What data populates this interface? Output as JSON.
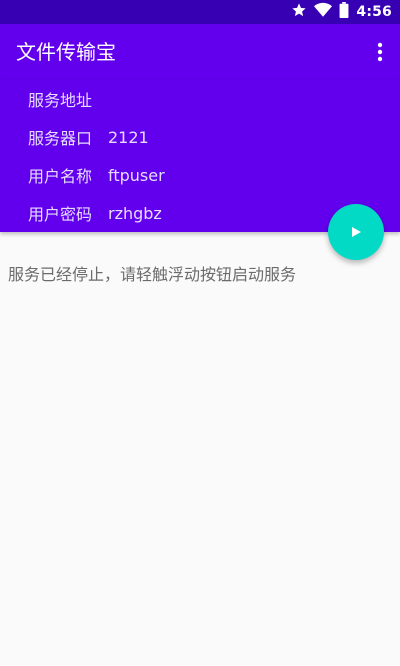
{
  "status_bar": {
    "time": "4:56",
    "icons": [
      "star-icon",
      "wifi-icon",
      "battery-icon"
    ]
  },
  "app_bar": {
    "title": "文件传输宝",
    "menu_icon": "more-vert-icon"
  },
  "info": {
    "address_label": "服务地址",
    "address_value": "",
    "port_label": "服务器口",
    "port_value": "2121",
    "username_label": "用户名称",
    "username_value": "ftpuser",
    "password_label": "用户密码",
    "password_value": "rzhgbz"
  },
  "fab": {
    "icon": "play-icon"
  },
  "main": {
    "message": "服务已经停止，请轻触浮动按钮启动服务"
  },
  "colors": {
    "status_bar": "#3700b3",
    "primary": "#6200ee",
    "accent": "#03dac5",
    "background": "#fafafa"
  }
}
